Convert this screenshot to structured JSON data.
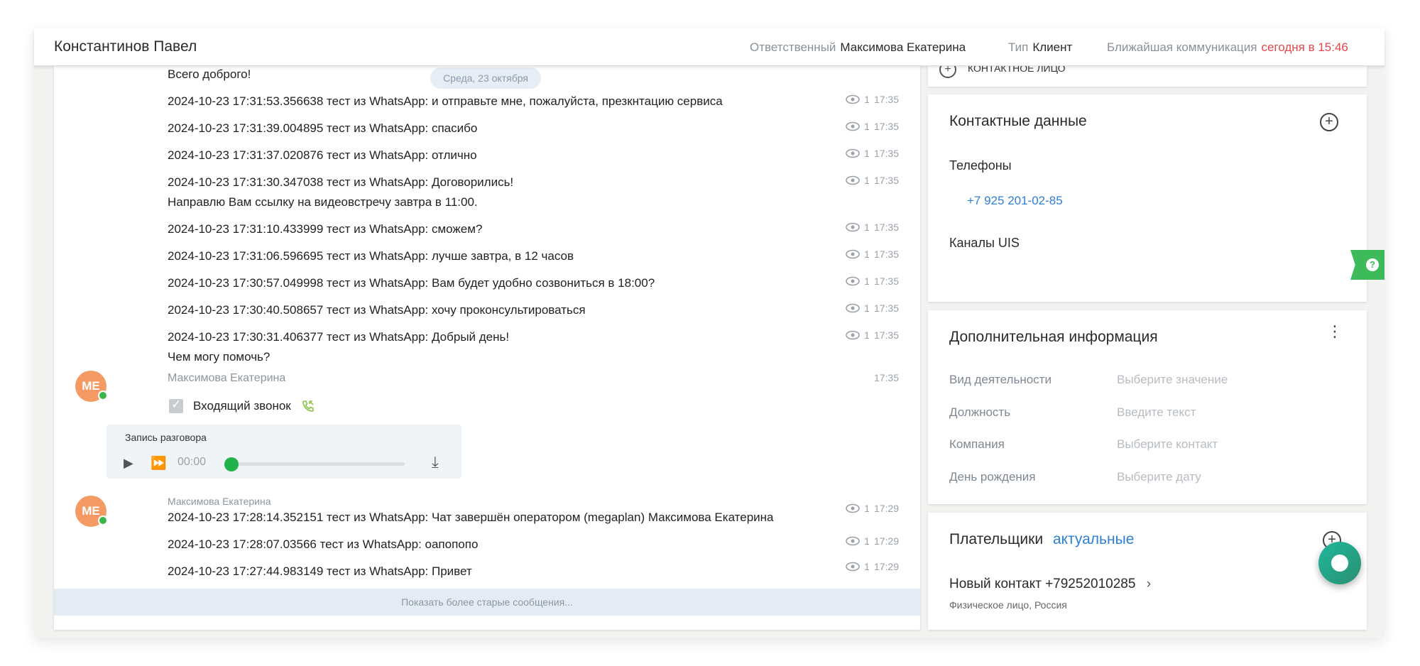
{
  "header": {
    "contact_name": "Константинов Павел",
    "responsible_label": "Ответственный",
    "responsible_value": "Максимова Екатерина",
    "type_label": "Тип",
    "type_value": "Клиент",
    "next_comm_label": "Ближайшая коммуникация",
    "next_comm_value": "сегодня в 15:46"
  },
  "chat": {
    "partial_top_message": "Всего доброго!",
    "date_separator": "Среда, 23 октября",
    "messages": [
      {
        "text": "2024-10-23 17:31:53.356638 тест из WhatsApp: и отправьте мне, пожалуйста, презкнтацию сервиса",
        "views": "1",
        "time": "17:35"
      },
      {
        "text": "2024-10-23 17:31:39.004895 тест из WhatsApp: спасибо",
        "views": "1",
        "time": "17:35"
      },
      {
        "text": "2024-10-23 17:31:37.020876 тест из WhatsApp: отлично",
        "views": "1",
        "time": "17:35"
      },
      {
        "text": "2024-10-23 17:31:30.347038 тест из WhatsApp: Договорились!",
        "text2": "Направлю Вам ссылку на видеовстречу завтра в 11:00.",
        "views": "1",
        "time": "17:35"
      },
      {
        "text": "2024-10-23 17:31:10.433999 тест из WhatsApp: сможем?",
        "views": "1",
        "time": "17:35"
      },
      {
        "text": "2024-10-23 17:31:06.596695 тест из WhatsApp: лучше завтра, в 12 часов",
        "views": "1",
        "time": "17:35"
      },
      {
        "text": "2024-10-23 17:30:57.049998 тест из WhatsApp: Вам будет удобно созвониться в 18:00?",
        "views": "1",
        "time": "17:35"
      },
      {
        "text": "2024-10-23 17:30:40.508657 тест из WhatsApp: хочу проконсультироваться",
        "views": "1",
        "time": "17:35"
      },
      {
        "text": "2024-10-23 17:30:31.406377 тест из WhatsApp: Добрый день!",
        "text2": "Чем могу помочь?",
        "views": "1",
        "time": "17:35"
      }
    ],
    "call_block": {
      "avatar_initials": "МЕ",
      "author": "Максимова Екатерина",
      "time": "17:35",
      "call_label": "Входящий звонок",
      "recording_title": "Запись разговора",
      "player_time": "00:00"
    },
    "second_block": {
      "avatar_initials": "МЕ",
      "author": "Максимова Екатерина",
      "messages": [
        {
          "text": "2024-10-23 17:28:14.352151 тест из WhatsApp: Чат завершён оператором (megaplan) Максимова Екатерина",
          "views": "1",
          "time": "17:29"
        },
        {
          "text": "2024-10-23 17:28:07.03566 тест из WhatsApp: оапопопо",
          "views": "1",
          "time": "17:29"
        },
        {
          "text": "2024-10-23 17:27:44.983149 тест из WhatsApp: Привет",
          "views": "1",
          "time": "17:29"
        }
      ]
    },
    "show_older": "Показать более старые сообщения..."
  },
  "right": {
    "partial_top": "КОНТАКТНОЕ ЛИЦО",
    "contacts": {
      "title": "Контактные данные",
      "phones_label": "Телефоны",
      "phone": "+7 925 201-02-85",
      "channels_label": "Каналы UIS"
    },
    "additional": {
      "title": "Дополнительная информация",
      "fields": [
        {
          "label": "Вид деятельности",
          "placeholder": "Выберите значение"
        },
        {
          "label": "Должность",
          "placeholder": "Введите текст"
        },
        {
          "label": "Компания",
          "placeholder": "Выберите контакт"
        },
        {
          "label": "День рождения",
          "placeholder": "Выберите дату"
        }
      ]
    },
    "payers": {
      "title": "Плательщики",
      "filter": "актуальные",
      "item_name": "Новый контакт +79252010285",
      "item_sub": "Физическое лицо, Россия"
    }
  },
  "colors": {
    "accent_blue": "#2e7fd5",
    "deadline_red": "#e4474a",
    "avatar_orange": "#f59a63",
    "online_green": "#3bb54a",
    "help_green": "#3dbb5a"
  },
  "icons": {
    "views": "eye-icon",
    "call": "phone-incoming-icon",
    "add": "plus-circle-icon",
    "menu": "vertical-dots-icon",
    "download": "download-icon"
  }
}
